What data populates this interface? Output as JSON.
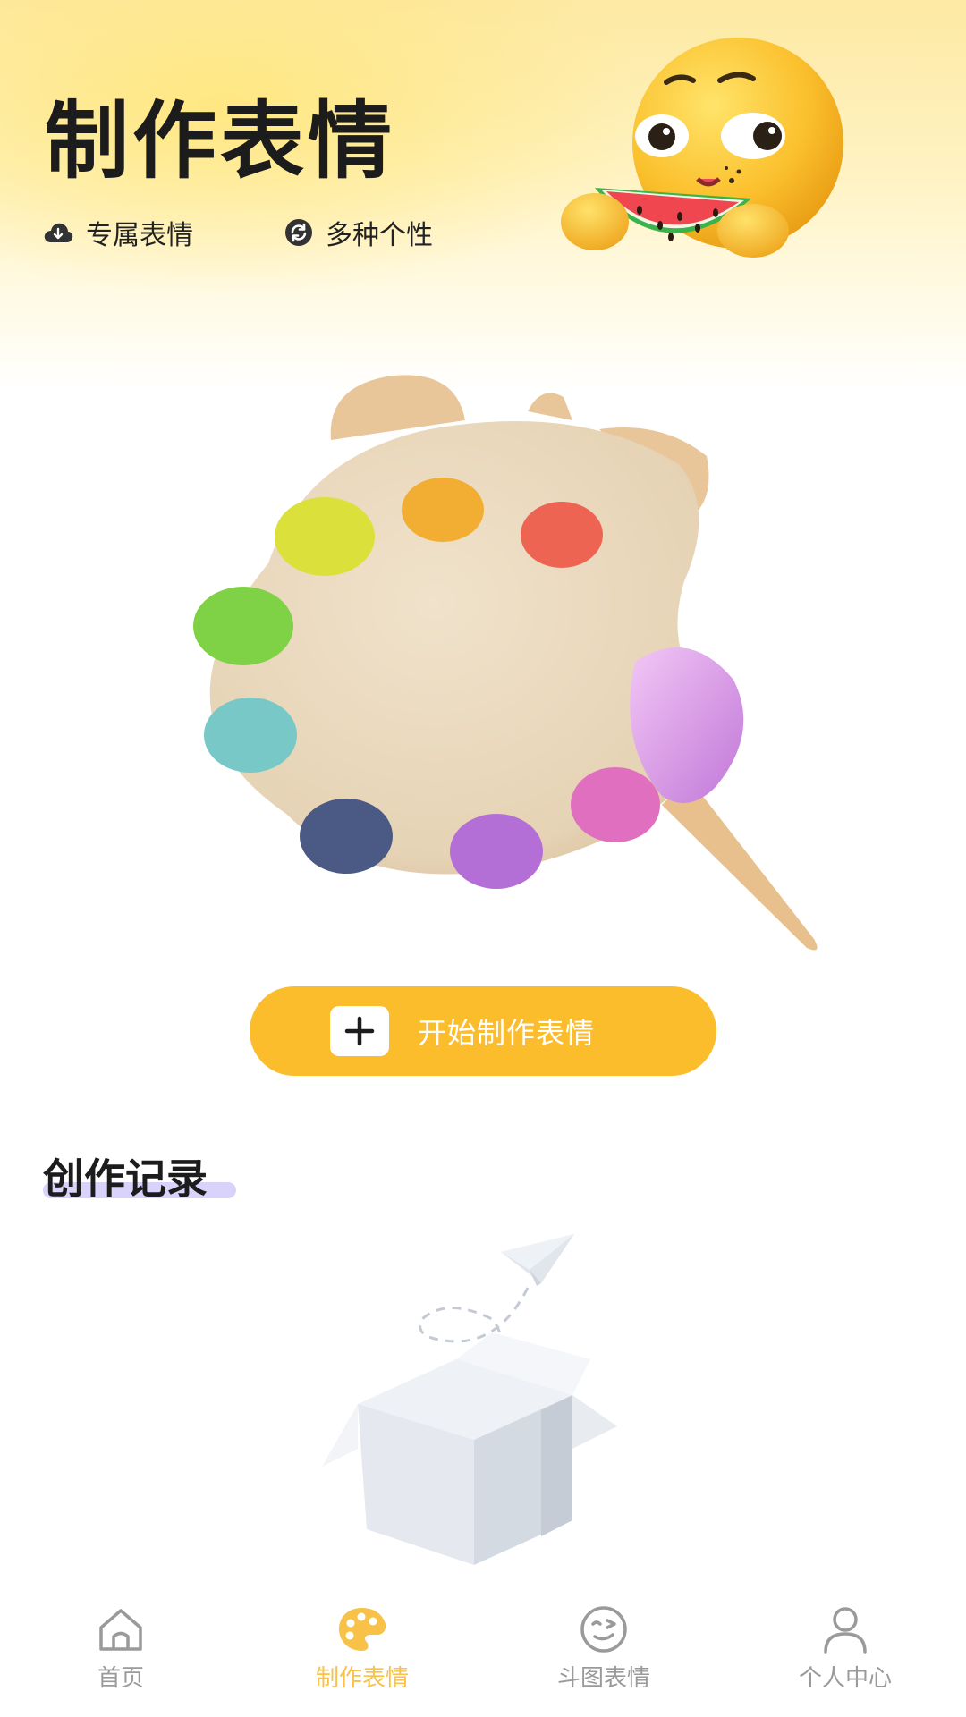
{
  "header": {
    "title": "制作表情",
    "features": [
      {
        "icon": "cloud-download-icon",
        "label": "专属表情"
      },
      {
        "icon": "refresh-circle-icon",
        "label": "多种个性"
      }
    ]
  },
  "cta": {
    "icon": "plus-icon",
    "label": "开始制作表情"
  },
  "section": {
    "title": "创作记录"
  },
  "bottom_nav": {
    "items": [
      {
        "icon": "home-icon",
        "label": "首页",
        "active": false
      },
      {
        "icon": "palette-icon",
        "label": "制作表情",
        "active": true
      },
      {
        "icon": "wink-face-icon",
        "label": "斗图表情",
        "active": false
      },
      {
        "icon": "person-icon",
        "label": "个人中心",
        "active": false
      }
    ]
  },
  "colors": {
    "accent": "#fbbd2c",
    "nav_active": "#f7c247",
    "nav_inactive": "#9a9a9a",
    "underline": "#d9d2fb"
  }
}
